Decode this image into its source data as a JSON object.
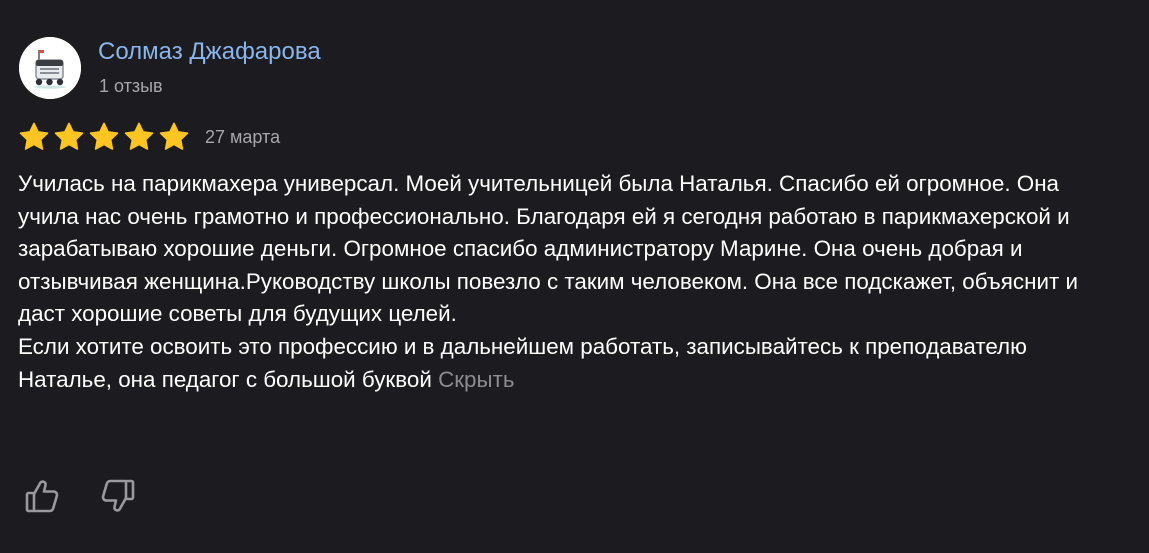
{
  "author": {
    "name": "Солмаз Джафарова",
    "meta": "1 отзыв",
    "avatar_icon": "robot-courier-icon"
  },
  "review": {
    "rating": 5,
    "rating_max": 5,
    "date": "27 марта",
    "text": "Училась на парикмахера универсал. Моей учительницей была Наталья. Спасибо ей огромное. Она учила нас очень грамотно и профессионально. Благодаря ей я сегодня работаю в парикмахерской и зарабатываю хорошие деньги. Огромное спасибо администратору Марине. Она очень добрая и отзывчивая женщина.Руководству школы повезло с таким человеком. Она все подскажет, объяснит и даст хорошие советы для будущих целей.\nЕсли хотите освоить это профессию и в дальнейшем работать, записывайтесь к преподавателю Наталье, она педагог с большой буквой",
    "hide_label": "Скрыть"
  },
  "actions": {
    "like_icon": "thumbs-up-icon",
    "dislike_icon": "thumbs-down-icon"
  },
  "colors": {
    "background": "#1c1b1f",
    "author_link": "#8ab4ec",
    "star": "#fcc521",
    "muted": "#a7a7ab"
  }
}
